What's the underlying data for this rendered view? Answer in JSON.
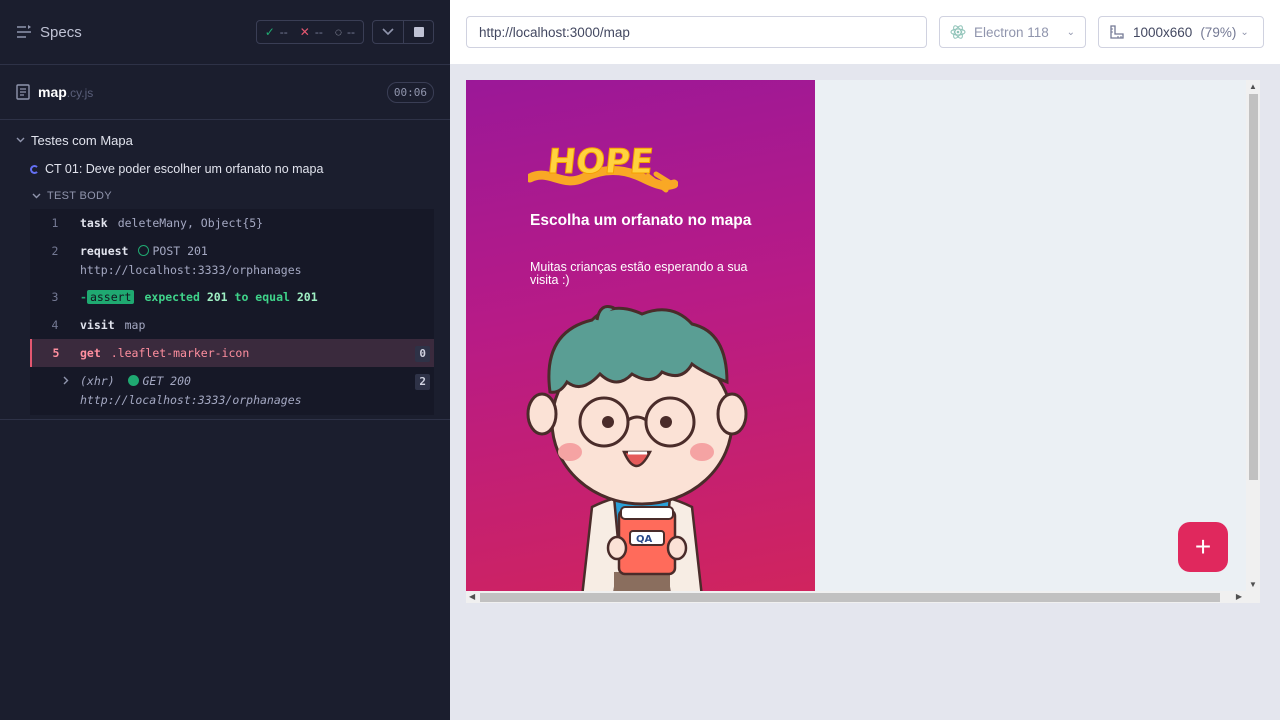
{
  "reporter": {
    "header": {
      "title": "Specs"
    },
    "stats": {
      "passed": "--",
      "failed": "--",
      "pending": "--"
    },
    "spec": {
      "name": "map",
      "ext": ".cy.js",
      "duration": "00:06"
    },
    "suite": {
      "title": "Testes com Mapa"
    },
    "test": {
      "title": "CT 01: Deve poder escolher um orfanato no mapa",
      "body_label": "TEST BODY"
    },
    "commands": [
      {
        "num": "1",
        "name": "task",
        "message": "deleteMany, Object{5}"
      },
      {
        "num": "2",
        "name": "request",
        "method": "POST 201",
        "url": "http://localhost:3333/orphanages"
      },
      {
        "num": "3",
        "dash": "-",
        "tag": "assert",
        "expected": "expected",
        "v1": "201",
        "mid": "to equal",
        "v2": "201"
      },
      {
        "num": "4",
        "name": "visit",
        "message": "map"
      },
      {
        "num": "5",
        "name": "get",
        "message": ".leaflet-marker-icon",
        "count": "0"
      }
    ],
    "xhr": {
      "prefix": "(xhr)",
      "method": "GET 200",
      "url": "http://localhost:3333/orphanages",
      "count": "2"
    }
  },
  "aut": {
    "url": "http://localhost:3000/map",
    "browser": "Electron 118",
    "viewport": "1000x660",
    "zoom": "(79%)",
    "app": {
      "logo_text": "HOPE",
      "title": "Escolha um orfanato no mapa",
      "subtitle": "Muitas crianças estão esperando a sua visita :)",
      "book_label": "QA",
      "fab_label": "+"
    }
  },
  "colors": {
    "accent": "#e0285d",
    "pass": "#1fa971",
    "fail": "#e45770",
    "sidebar_start": "#9b1898",
    "sidebar_end": "#d0245e"
  }
}
